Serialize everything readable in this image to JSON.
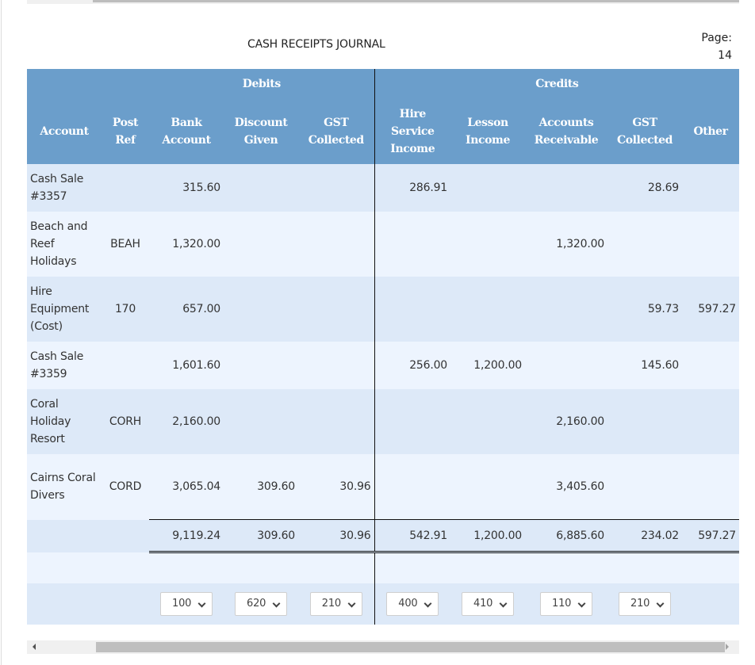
{
  "journal": {
    "title": "CASH RECEIPTS JOURNAL",
    "page_label": "Page:",
    "page_number": "14"
  },
  "header": {
    "debits_label": "Debits",
    "credits_label": "Credits",
    "columns": {
      "account": "Account",
      "post_ref": "Post Ref",
      "bank_account": "Bank Account",
      "discount_given": "Discount Given",
      "gst_collected_dr": "GST Collected",
      "hire_service_income": "Hire Service Income",
      "lesson_income": "Lesson Income",
      "accounts_receivable": "Accounts Receivable",
      "gst_collected_cr": "GST Collected",
      "other": "Other"
    }
  },
  "rows": [
    {
      "account": "Cash Sale #3357",
      "post_ref": "",
      "bank": "315.60",
      "discount": "",
      "gst_dr": "",
      "hire": "286.91",
      "lesson": "",
      "ar": "",
      "gst_cr": "28.69",
      "other": ""
    },
    {
      "account": "Beach and Reef Holidays",
      "post_ref": "BEAH",
      "bank": "1,320.00",
      "discount": "",
      "gst_dr": "",
      "hire": "",
      "lesson": "",
      "ar": "1,320.00",
      "gst_cr": "",
      "other": ""
    },
    {
      "account": "Hire Equipment (Cost)",
      "post_ref": "170",
      "bank": "657.00",
      "discount": "",
      "gst_dr": "",
      "hire": "",
      "lesson": "",
      "ar": "",
      "gst_cr": "59.73",
      "other": "597.27"
    },
    {
      "account": "Cash Sale #3359",
      "post_ref": "",
      "bank": "1,601.60",
      "discount": "",
      "gst_dr": "",
      "hire": "256.00",
      "lesson": "1,200.00",
      "ar": "",
      "gst_cr": "145.60",
      "other": ""
    },
    {
      "account": "Coral Holiday Resort",
      "post_ref": "CORH",
      "bank": "2,160.00",
      "discount": "",
      "gst_dr": "",
      "hire": "",
      "lesson": "",
      "ar": "2,160.00",
      "gst_cr": "",
      "other": ""
    },
    {
      "account": "Cairns Coral Divers",
      "post_ref": "CORD",
      "bank": "3,065.04",
      "discount": "309.60",
      "gst_dr": "30.96",
      "hire": "",
      "lesson": "",
      "ar": "3,405.60",
      "gst_cr": "",
      "other": ""
    }
  ],
  "totals": {
    "bank": "9,119.24",
    "discount": "309.60",
    "gst_dr": "30.96",
    "hire": "542.91",
    "lesson": "1,200.00",
    "ar": "6,885.60",
    "gst_cr": "234.02",
    "other": "597.27"
  },
  "account_selects": {
    "bank": "100",
    "discount": "620",
    "gst_dr": "210",
    "hire": "400",
    "lesson": "410",
    "ar": "110",
    "gst_cr": "210"
  },
  "icons": {
    "select_chevron": "chevron-down-icon",
    "scroll_left": "arrow-left-icon",
    "scroll_right": "arrow-right-icon"
  }
}
